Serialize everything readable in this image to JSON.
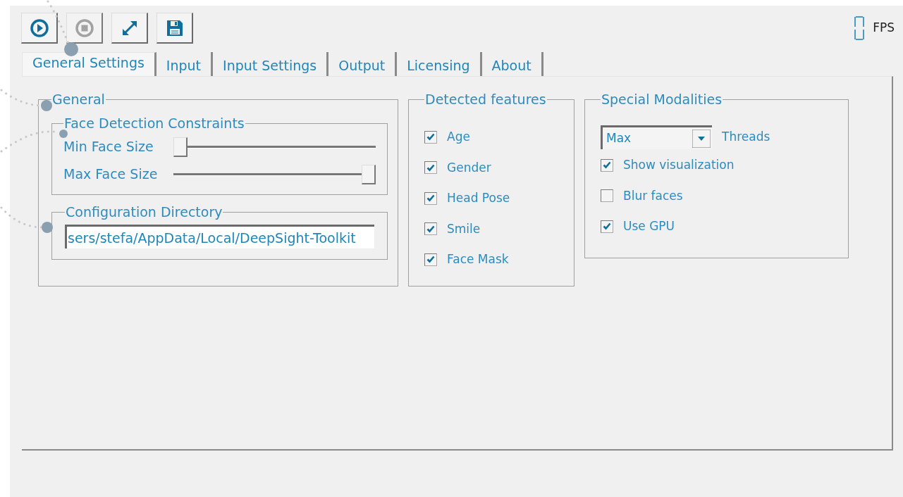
{
  "toolbar": [
    {
      "kind": "play",
      "disabled": false
    },
    {
      "kind": "stop",
      "disabled": true
    },
    {
      "kind": "expand",
      "disabled": false
    },
    {
      "kind": "save",
      "disabled": false
    }
  ],
  "fps": {
    "label": "FPS"
  },
  "tabs": [
    {
      "label": "General Settings",
      "selected": true
    },
    {
      "label": "Input",
      "selected": false
    },
    {
      "label": "Input Settings",
      "selected": false
    },
    {
      "label": "Output",
      "selected": false
    },
    {
      "label": "Licensing",
      "selected": false
    },
    {
      "label": "About",
      "selected": false
    }
  ],
  "general": {
    "title": "General",
    "face_detection": {
      "title": "Face Detection Constraints",
      "sliders": [
        {
          "label": "Min Face Size",
          "level": 0
        },
        {
          "label": "Max Face Size",
          "level": 1
        }
      ]
    },
    "config_directory": {
      "title": "Configuration Directory",
      "value": "sers/stefa/AppData/Local/DeepSight-Toolkit"
    }
  },
  "detected_features": {
    "title": "Detected features",
    "items": [
      {
        "label": "Age",
        "checked": true
      },
      {
        "label": "Gender",
        "checked": true
      },
      {
        "label": "Head Pose",
        "checked": true
      },
      {
        "label": "Smile",
        "checked": true
      },
      {
        "label": "Face Mask",
        "checked": true
      }
    ]
  },
  "special_modalities": {
    "title": "Special Modalities",
    "threads": {
      "value": "Max",
      "label": "Threads"
    },
    "options": [
      {
        "label": "Show visualization",
        "checked": true
      },
      {
        "label": "Blur faces",
        "checked": false
      },
      {
        "label": "Use GPU",
        "checked": true
      }
    ]
  }
}
